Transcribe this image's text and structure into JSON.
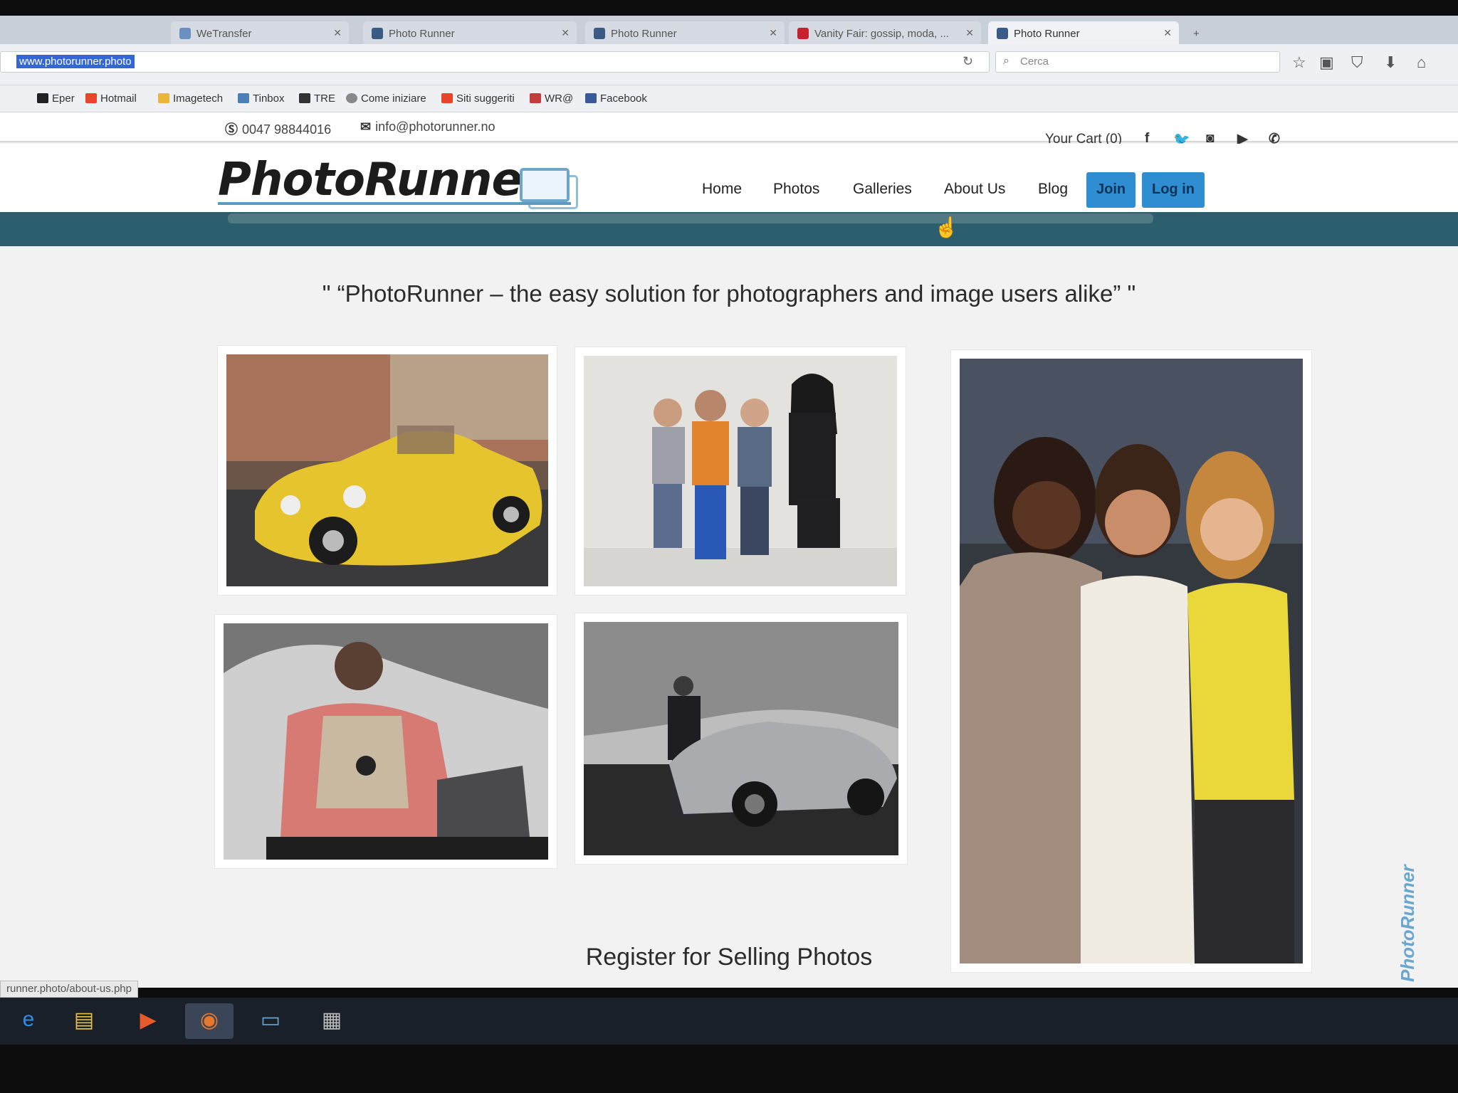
{
  "browser": {
    "tabs": [
      {
        "label": "WeTransfer",
        "active": false
      },
      {
        "label": "Photo Runner",
        "active": false
      },
      {
        "label": "Photo Runner",
        "active": false
      },
      {
        "label": "Vanity Fair: gossip, moda, ...",
        "active": false
      },
      {
        "label": "Photo Runner",
        "active": true
      }
    ],
    "url": "www.photorunner.photo",
    "search_placeholder": "Cerca",
    "bookmarks": [
      {
        "label": "Eper",
        "color": "#222"
      },
      {
        "label": "Hotmail",
        "color": "#e8442a"
      },
      {
        "label": "Imagetech",
        "color": "#e9b53a"
      },
      {
        "label": "Tinbox",
        "color": "#4a7fb8"
      },
      {
        "label": "TRE",
        "color": "#333"
      },
      {
        "label": "Come iniziare",
        "color": "#888"
      },
      {
        "label": "Siti suggeriti",
        "color": "#e8442a"
      },
      {
        "label": "WR@",
        "color": "#c43a3a"
      },
      {
        "label": "Facebook",
        "color": "#3b5998"
      }
    ],
    "status_url": "runner.photo/about-us.php"
  },
  "site": {
    "phone": "0047 98844016",
    "email": "info@photorunner.no",
    "cart_label": "Your Cart (0)",
    "social_icons": [
      "facebook-icon",
      "twitter-icon",
      "instagram-icon",
      "youtube-icon",
      "whatsapp-icon"
    ],
    "logo_text": "PhotoRunner",
    "nav": [
      "Home",
      "Photos",
      "Galleries",
      "About Us",
      "Blog"
    ],
    "join_label": "Join",
    "login_label": "Log in",
    "accent": "#2f8ed1",
    "banner_color": "#2b5f6e",
    "quote": "\" “PhotoRunner – the easy solution for photographers and image users alike” \"",
    "photos": [
      {
        "name": "photo-yellow-convertible",
        "subject": "yellow vintage convertible car"
      },
      {
        "name": "photo-children-woman",
        "subject": "children sitting with a woman"
      },
      {
        "name": "photo-three-women",
        "subject": "three smiling women"
      },
      {
        "name": "photo-photographer-laptop",
        "subject": "photographer with camera and laptop"
      },
      {
        "name": "photo-man-silver-car",
        "subject": "man beside silver sports car"
      }
    ],
    "register_heading": "Register for Selling Photos"
  },
  "taskbar": {
    "apps": [
      "internet-explorer-icon",
      "file-explorer-icon",
      "media-player-icon",
      "firefox-icon",
      "photo-viewer-icon",
      "document-icon"
    ]
  },
  "watermark": "PhotoRunner"
}
